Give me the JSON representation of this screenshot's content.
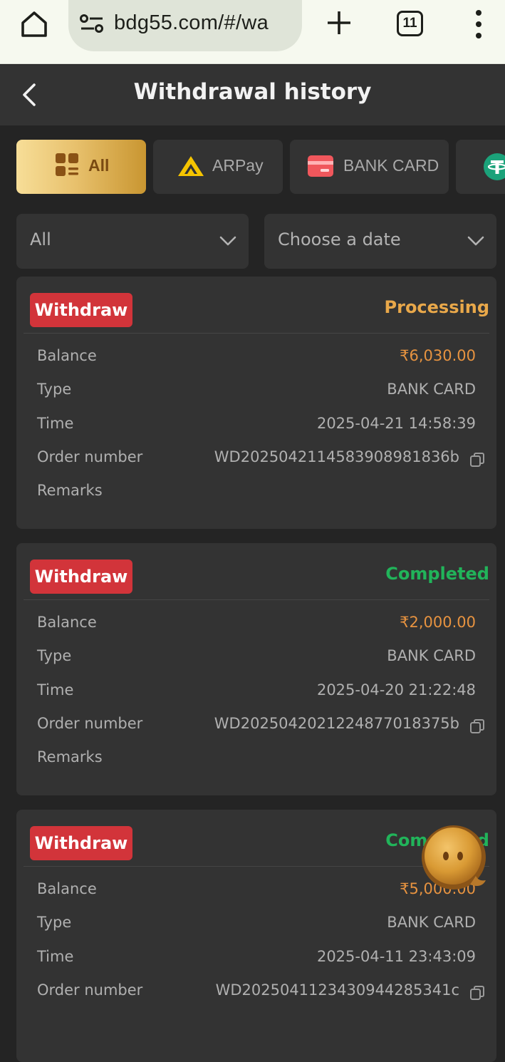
{
  "browser": {
    "url": "bdg55.com/#/wa",
    "tab_count": "11"
  },
  "header": {
    "title": "Withdrawal history"
  },
  "tabs": [
    {
      "label": "All",
      "active": true
    },
    {
      "label": "ARPay",
      "active": false
    },
    {
      "label": "BANK CARD",
      "active": false
    },
    {
      "label": "",
      "active": false
    }
  ],
  "filters": {
    "type_value": "All",
    "date_placeholder": "Choose a date"
  },
  "labels": {
    "balance": "Balance",
    "type": "Type",
    "time": "Time",
    "order_number": "Order number",
    "remarks": "Remarks"
  },
  "records": [
    {
      "badge": "Withdraw",
      "status": "Processing",
      "balance": "₹6,030.00",
      "type": "BANK CARD",
      "time": "2025-04-21 14:58:39",
      "order_number": "WD2025042114583908981836b",
      "remarks": ""
    },
    {
      "badge": "Withdraw",
      "status": "Completed",
      "balance": "₹2,000.00",
      "type": "BANK CARD",
      "time": "2025-04-20 21:22:48",
      "order_number": "WD2025042021224877018375b",
      "remarks": ""
    },
    {
      "badge": "Withdraw",
      "status": "Completed",
      "balance": "₹5,000.00",
      "type": "BANK CARD",
      "time": "2025-04-11 23:43:09",
      "order_number": "WD2025041123430944285341c",
      "remarks": ""
    }
  ],
  "colors": {
    "accent_gold": "#e8c16d",
    "badge_red": "#d2343a",
    "processing": "#e9a84a",
    "completed": "#21b45a",
    "money": "#e79340"
  }
}
